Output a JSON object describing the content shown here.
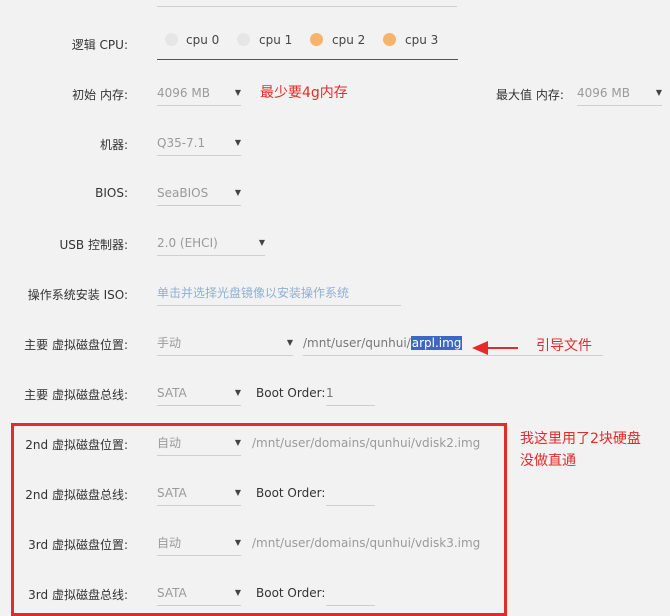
{
  "cpus": {
    "label": "逻辑 CPU:",
    "items": [
      {
        "name": "cpu 0",
        "state": "off"
      },
      {
        "name": "cpu 1",
        "state": "off"
      },
      {
        "name": "cpu 2",
        "state": "on"
      },
      {
        "name": "cpu 3",
        "state": "on"
      }
    ]
  },
  "memory": {
    "label": "初始 内存:",
    "value": "4096 MB",
    "max_label": "最大值 内存:",
    "max_value": "4096 MB",
    "note": "最少要4g内存"
  },
  "machine": {
    "label": "机器:",
    "value": "Q35-7.1"
  },
  "bios": {
    "label": "BIOS:",
    "value": "SeaBIOS"
  },
  "usb": {
    "label": "USB 控制器:",
    "value": "2.0 (EHCI)"
  },
  "iso": {
    "label": "操作系统安装 ISO:",
    "placeholder": "单击并选择光盘镜像以安装操作系统"
  },
  "primary_disk": {
    "location_label": "主要 虚拟磁盘位置:",
    "mode": "手动",
    "path_prefix": "/mnt/user/qunhui/",
    "path_highlight": "arpl.img",
    "note": "引导文件",
    "bus_label": "主要 虚拟磁盘总线:",
    "bus": "SATA",
    "boot_order_label": "Boot Order:",
    "boot_order": "1"
  },
  "disk2": {
    "location_label": "2nd 虚拟磁盘位置:",
    "mode": "自动",
    "path": "/mnt/user/domains/qunhui/vdisk2.img",
    "bus_label": "2nd 虚拟磁盘总线:",
    "bus": "SATA",
    "boot_order_label": "Boot Order:",
    "boot_order": ""
  },
  "disk3": {
    "location_label": "3rd 虚拟磁盘位置:",
    "mode": "自动",
    "path": "/mnt/user/domains/qunhui/vdisk3.img",
    "bus_label": "3rd 虚拟磁盘总线:",
    "bus": "SATA",
    "boot_order_label": "Boot Order:",
    "boot_order": ""
  },
  "disks_note_line1": "我这里用了2块硬盘",
  "disks_note_line2": "没做直通",
  "colors": {
    "annotation": "#e32b2b",
    "selected_dot": "#f6b36b",
    "highlight": "#3c67c4"
  }
}
